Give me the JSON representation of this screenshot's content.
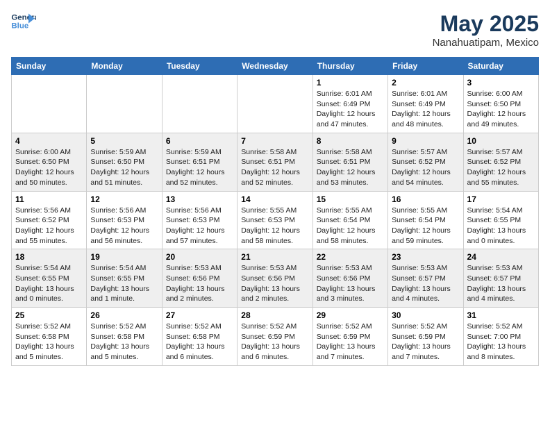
{
  "header": {
    "logo_line1": "General",
    "logo_line2": "Blue",
    "month": "May 2025",
    "location": "Nanahuatipam, Mexico"
  },
  "weekdays": [
    "Sunday",
    "Monday",
    "Tuesday",
    "Wednesday",
    "Thursday",
    "Friday",
    "Saturday"
  ],
  "weeks": [
    [
      {
        "day": "",
        "info": ""
      },
      {
        "day": "",
        "info": ""
      },
      {
        "day": "",
        "info": ""
      },
      {
        "day": "",
        "info": ""
      },
      {
        "day": "1",
        "info": "Sunrise: 6:01 AM\nSunset: 6:49 PM\nDaylight: 12 hours\nand 47 minutes."
      },
      {
        "day": "2",
        "info": "Sunrise: 6:01 AM\nSunset: 6:49 PM\nDaylight: 12 hours\nand 48 minutes."
      },
      {
        "day": "3",
        "info": "Sunrise: 6:00 AM\nSunset: 6:50 PM\nDaylight: 12 hours\nand 49 minutes."
      }
    ],
    [
      {
        "day": "4",
        "info": "Sunrise: 6:00 AM\nSunset: 6:50 PM\nDaylight: 12 hours\nand 50 minutes."
      },
      {
        "day": "5",
        "info": "Sunrise: 5:59 AM\nSunset: 6:50 PM\nDaylight: 12 hours\nand 51 minutes."
      },
      {
        "day": "6",
        "info": "Sunrise: 5:59 AM\nSunset: 6:51 PM\nDaylight: 12 hours\nand 52 minutes."
      },
      {
        "day": "7",
        "info": "Sunrise: 5:58 AM\nSunset: 6:51 PM\nDaylight: 12 hours\nand 52 minutes."
      },
      {
        "day": "8",
        "info": "Sunrise: 5:58 AM\nSunset: 6:51 PM\nDaylight: 12 hours\nand 53 minutes."
      },
      {
        "day": "9",
        "info": "Sunrise: 5:57 AM\nSunset: 6:52 PM\nDaylight: 12 hours\nand 54 minutes."
      },
      {
        "day": "10",
        "info": "Sunrise: 5:57 AM\nSunset: 6:52 PM\nDaylight: 12 hours\nand 55 minutes."
      }
    ],
    [
      {
        "day": "11",
        "info": "Sunrise: 5:56 AM\nSunset: 6:52 PM\nDaylight: 12 hours\nand 55 minutes."
      },
      {
        "day": "12",
        "info": "Sunrise: 5:56 AM\nSunset: 6:53 PM\nDaylight: 12 hours\nand 56 minutes."
      },
      {
        "day": "13",
        "info": "Sunrise: 5:56 AM\nSunset: 6:53 PM\nDaylight: 12 hours\nand 57 minutes."
      },
      {
        "day": "14",
        "info": "Sunrise: 5:55 AM\nSunset: 6:53 PM\nDaylight: 12 hours\nand 58 minutes."
      },
      {
        "day": "15",
        "info": "Sunrise: 5:55 AM\nSunset: 6:54 PM\nDaylight: 12 hours\nand 58 minutes."
      },
      {
        "day": "16",
        "info": "Sunrise: 5:55 AM\nSunset: 6:54 PM\nDaylight: 12 hours\nand 59 minutes."
      },
      {
        "day": "17",
        "info": "Sunrise: 5:54 AM\nSunset: 6:55 PM\nDaylight: 13 hours\nand 0 minutes."
      }
    ],
    [
      {
        "day": "18",
        "info": "Sunrise: 5:54 AM\nSunset: 6:55 PM\nDaylight: 13 hours\nand 0 minutes."
      },
      {
        "day": "19",
        "info": "Sunrise: 5:54 AM\nSunset: 6:55 PM\nDaylight: 13 hours\nand 1 minute."
      },
      {
        "day": "20",
        "info": "Sunrise: 5:53 AM\nSunset: 6:56 PM\nDaylight: 13 hours\nand 2 minutes."
      },
      {
        "day": "21",
        "info": "Sunrise: 5:53 AM\nSunset: 6:56 PM\nDaylight: 13 hours\nand 2 minutes."
      },
      {
        "day": "22",
        "info": "Sunrise: 5:53 AM\nSunset: 6:56 PM\nDaylight: 13 hours\nand 3 minutes."
      },
      {
        "day": "23",
        "info": "Sunrise: 5:53 AM\nSunset: 6:57 PM\nDaylight: 13 hours\nand 4 minutes."
      },
      {
        "day": "24",
        "info": "Sunrise: 5:53 AM\nSunset: 6:57 PM\nDaylight: 13 hours\nand 4 minutes."
      }
    ],
    [
      {
        "day": "25",
        "info": "Sunrise: 5:52 AM\nSunset: 6:58 PM\nDaylight: 13 hours\nand 5 minutes."
      },
      {
        "day": "26",
        "info": "Sunrise: 5:52 AM\nSunset: 6:58 PM\nDaylight: 13 hours\nand 5 minutes."
      },
      {
        "day": "27",
        "info": "Sunrise: 5:52 AM\nSunset: 6:58 PM\nDaylight: 13 hours\nand 6 minutes."
      },
      {
        "day": "28",
        "info": "Sunrise: 5:52 AM\nSunset: 6:59 PM\nDaylight: 13 hours\nand 6 minutes."
      },
      {
        "day": "29",
        "info": "Sunrise: 5:52 AM\nSunset: 6:59 PM\nDaylight: 13 hours\nand 7 minutes."
      },
      {
        "day": "30",
        "info": "Sunrise: 5:52 AM\nSunset: 6:59 PM\nDaylight: 13 hours\nand 7 minutes."
      },
      {
        "day": "31",
        "info": "Sunrise: 5:52 AM\nSunset: 7:00 PM\nDaylight: 13 hours\nand 8 minutes."
      }
    ]
  ]
}
